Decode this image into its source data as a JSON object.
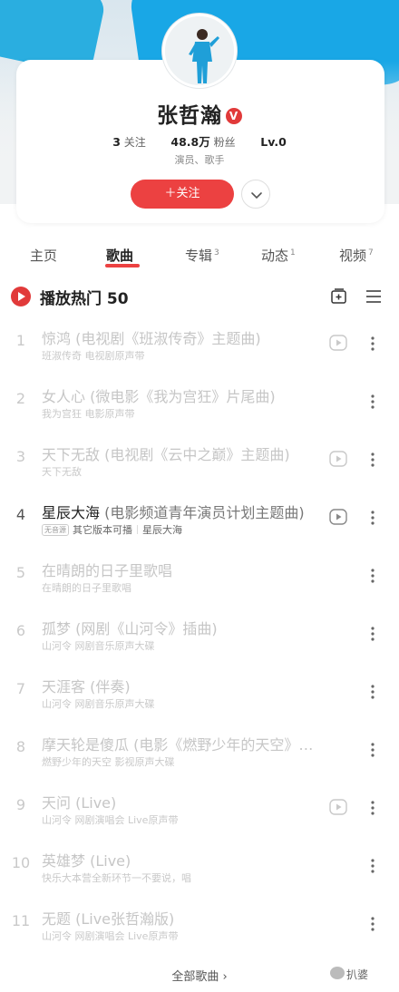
{
  "artist": {
    "name": "张哲瀚",
    "verified_badge": "V",
    "stats": [
      {
        "value": "3",
        "label": "关注"
      },
      {
        "value": "48.8万",
        "label": "粉丝"
      },
      {
        "value": "Lv.0",
        "label": ""
      }
    ],
    "roles": "演员、歌手",
    "follow_button": "＋关注"
  },
  "tabs": [
    {
      "label": "主页",
      "count": ""
    },
    {
      "label": "歌曲",
      "count": ""
    },
    {
      "label": "专辑",
      "count": "3"
    },
    {
      "label": "动态",
      "count": "1"
    },
    {
      "label": "视频",
      "count": "7"
    }
  ],
  "active_tab": "歌曲",
  "section": {
    "title": "播放热门 50"
  },
  "songs": [
    {
      "num": "1",
      "title": "惊鸿",
      "extra": " (电视剧《班淑传奇》主题曲)",
      "sub": "班淑传奇 电视剧原声带",
      "playable": false,
      "mv": true
    },
    {
      "num": "2",
      "title": "女人心",
      "extra": " (微电影《我为宫狂》片尾曲)",
      "sub": "我为宫狂 电影原声带",
      "playable": false,
      "mv": false
    },
    {
      "num": "3",
      "title": "天下无敌",
      "extra": " (电视剧《云中之巅》主题曲)",
      "sub": "天下无敌",
      "playable": false,
      "mv": true
    },
    {
      "num": "4",
      "title": "星辰大海",
      "extra": " (电影频道青年演员计划主题曲)",
      "sub_tag": "无音源",
      "sub": "其它版本可播",
      "sub2": "星辰大海",
      "playable": true,
      "mv": true
    },
    {
      "num": "5",
      "title": "在晴朗的日子里歌唱",
      "extra": "",
      "sub": "在晴朗的日子里歌唱",
      "playable": false,
      "mv": false
    },
    {
      "num": "6",
      "title": "孤梦",
      "extra": " (网剧《山河令》插曲)",
      "sub": "山河令 网剧音乐原声大碟",
      "playable": false,
      "mv": false
    },
    {
      "num": "7",
      "title": "天涯客",
      "extra": " (伴奏)",
      "sub": "山河令 网剧音乐原声大碟",
      "playable": false,
      "mv": false
    },
    {
      "num": "8",
      "title": "摩天轮是傻瓜",
      "extra": " (电影《燃野少年的天空》插曲)",
      "sub": "燃野少年的天空 影视原声大碟",
      "playable": false,
      "mv": false
    },
    {
      "num": "9",
      "title": "天问",
      "extra": " (Live)",
      "sub": "山河令 网剧演唱会 Live原声带",
      "playable": false,
      "mv": true
    },
    {
      "num": "10",
      "title": "英雄梦",
      "extra": " (Live)",
      "sub": "快乐大本营全新环节一不要说，唱",
      "playable": false,
      "mv": false
    },
    {
      "num": "11",
      "title": "无题",
      "extra": " (Live张哲瀚版)",
      "sub": "山河令 网剧演唱会 Live原声带",
      "playable": false,
      "mv": false
    }
  ],
  "all_songs_link": "全部歌曲 ›",
  "watermark": "扒婆",
  "colors": {
    "accent": "#ec4141",
    "banner_blue": "#19a7e6"
  }
}
